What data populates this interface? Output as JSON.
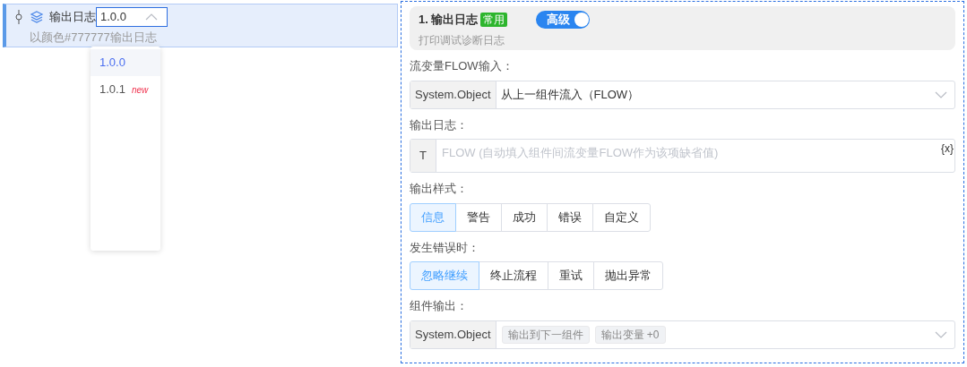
{
  "node": {
    "title": "输出日志",
    "description": "以颜色#777777输出日志",
    "version": {
      "value": "1.0.0",
      "expanded": true,
      "options": [
        {
          "label": "1.0.0",
          "selected": true
        },
        {
          "label": "1.0.1",
          "badge": "new",
          "selected": false
        }
      ]
    }
  },
  "panel": {
    "header": {
      "title": "1. 输出日志",
      "tag": "常用",
      "toggle": {
        "label": "高级",
        "on": true
      },
      "subtitle": "打印调试诊断日志"
    },
    "fields": [
      {
        "kind": "select",
        "label": "流变量FLOW输入：",
        "prefix": "System.Object",
        "value": "从上一组件流入（FLOW）"
      },
      {
        "kind": "textarea",
        "label": "输出日志：",
        "prefix": "T",
        "placeholder": "FLOW (自动填入组件间流变量FLOW作为该项缺省值)",
        "suffix": "{x}"
      },
      {
        "kind": "segmented",
        "label": "输出样式：",
        "options": [
          {
            "label": "信息",
            "selected": true
          },
          {
            "label": "警告",
            "selected": false
          },
          {
            "label": "成功",
            "selected": false
          },
          {
            "label": "错误",
            "selected": false
          },
          {
            "label": "自定义",
            "selected": false
          }
        ]
      },
      {
        "kind": "segmented",
        "label": "发生错误时：",
        "options": [
          {
            "label": "忽略继续",
            "selected": true
          },
          {
            "label": "终止流程",
            "selected": false
          },
          {
            "label": "重试",
            "selected": false
          },
          {
            "label": "抛出异常",
            "selected": false
          }
        ]
      },
      {
        "kind": "tags",
        "label": "组件输出：",
        "prefix": "System.Object",
        "tags": [
          "输出到下一组件",
          "输出变量 +0"
        ]
      }
    ]
  }
}
